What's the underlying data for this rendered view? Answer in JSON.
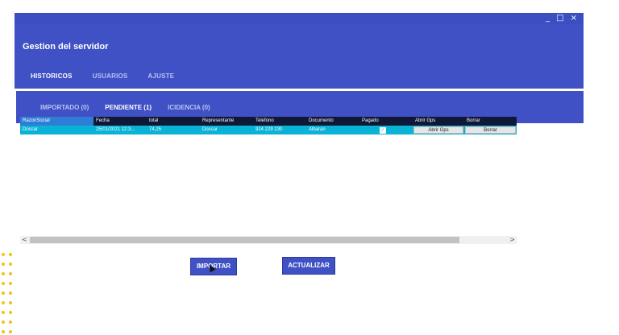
{
  "window": {
    "app_title": "Gestion del servidor",
    "controls": [
      "_",
      "□",
      "×"
    ]
  },
  "main_tabs": [
    {
      "label": "HISTORICOS",
      "active": true
    },
    {
      "label": "USUARIOS",
      "active": false
    },
    {
      "label": "AJUSTE",
      "active": false
    }
  ],
  "sub_tabs": [
    {
      "label": "IMPORTADO (0)",
      "active": false
    },
    {
      "label": "PENDIENTE (1)",
      "active": true
    },
    {
      "label": "ICIDENCIA (0)",
      "active": false
    }
  ],
  "grid": {
    "columns": [
      "RazonSocial",
      "Fecha",
      "total",
      "Representante",
      "Telefono",
      "Documento",
      "Pagado",
      "Abrir Gps",
      "Borrar"
    ],
    "rows": [
      {
        "razon_social": "Doscar",
        "fecha": "25/01/2021 12:3...",
        "total": "74,25",
        "representante": "Doscar",
        "telefono": "924 229 230",
        "documento": "Albaran",
        "pagado": true,
        "abrir_gps_label": "Abrir Gps",
        "borrar_label": "Borrar"
      }
    ]
  },
  "scrollbar": {
    "left_arrow": "<",
    "right_arrow": ">"
  },
  "buttons": {
    "importar": "IMPORTAR",
    "actualizar": "ACTUALIZAR"
  },
  "colors": {
    "primary": "#3f51c4",
    "header_row": "#0f1836",
    "row_selected": "#08b3d6",
    "tab_indicator": "#f57fb0",
    "accent_dots": "#f2c21a"
  }
}
